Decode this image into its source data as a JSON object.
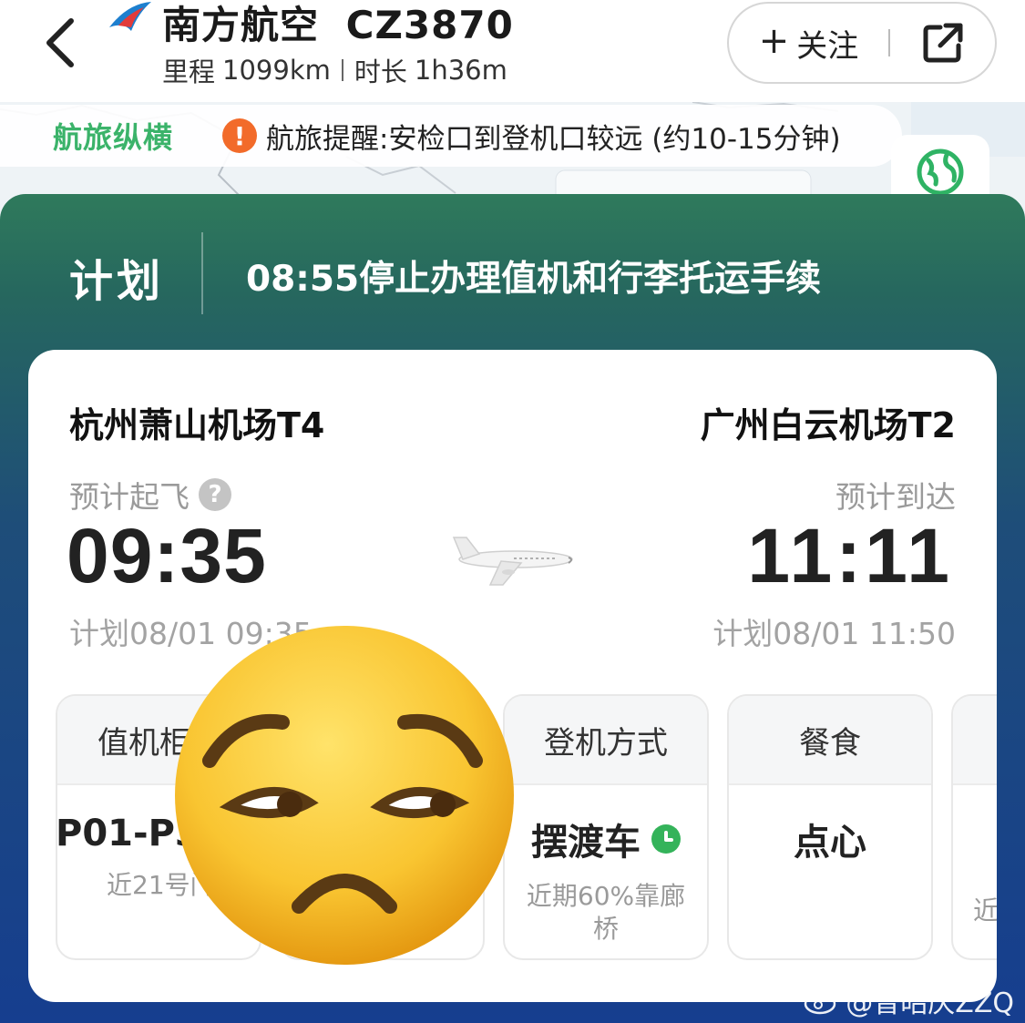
{
  "header": {
    "airline": "南方航空",
    "flight_no": "CZ3870",
    "distance_label": "里程",
    "distance": "1099km",
    "duration_label": "时长",
    "duration": "1h36m",
    "follow_label": "关注"
  },
  "alert": {
    "brand": "航旅纵横",
    "text": "航旅提醒:安检口到登机口较远 (约10-15分钟)"
  },
  "plan": {
    "label": "计划",
    "text": "08:55停止办理值机和行李托运手续"
  },
  "departure": {
    "airport": "杭州萧山机场T4",
    "label": "预计起飞",
    "time": "09:35",
    "planned": "计划08/01 09:35"
  },
  "arrival": {
    "airport": "广州白云机场T2",
    "label": "预计到达",
    "time": "11:11",
    "planned": "计划08/01 11:50"
  },
  "tiles": [
    {
      "title": "值机柜",
      "value": "P01-P3",
      "sub": "近21号门"
    },
    {
      "title": "",
      "value": "",
      "sub": ""
    },
    {
      "title": "登机方式",
      "value": "摆渡车",
      "sub": "近期60%靠廊桥"
    },
    {
      "title": "餐食",
      "value": "点心",
      "sub": ""
    },
    {
      "title": "",
      "value": "",
      "sub": "近"
    }
  ],
  "watermark": "@曾昭庆ZZQ",
  "colors": {
    "brand_green": "#3bb36a",
    "alert_orange": "#f26b2a",
    "panel_top": "#2f7a5c",
    "panel_bottom": "#163e8f",
    "clock_green": "#34b35a"
  },
  "icons": {
    "back": "chevron-left-icon",
    "airline": "china-southern-logo-icon",
    "share": "share-icon",
    "alert": "exclamation-icon",
    "globe": "globe-icon",
    "plane": "airplane-icon",
    "help": "question-icon",
    "clock": "clock-icon",
    "emoji": "unamused-face-icon"
  }
}
